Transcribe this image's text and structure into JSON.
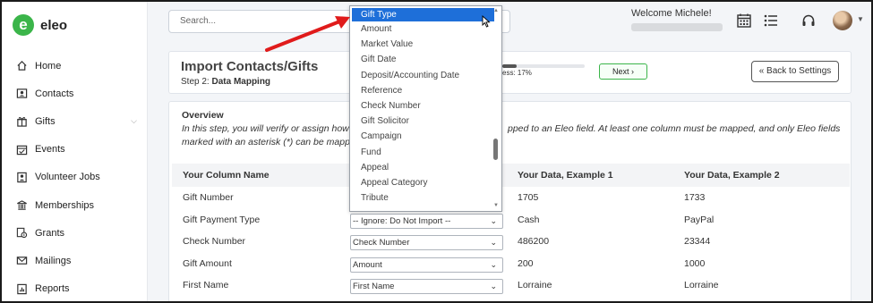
{
  "app": {
    "logo_letter": "e",
    "logo_text": "eleo"
  },
  "sidebar": {
    "items": [
      {
        "label": "Home",
        "icon": "home-icon"
      },
      {
        "label": "Contacts",
        "icon": "contacts-icon"
      },
      {
        "label": "Gifts",
        "icon": "gift-icon",
        "expandable": true
      },
      {
        "label": "Events",
        "icon": "events-icon"
      },
      {
        "label": "Volunteer Jobs",
        "icon": "volunteer-icon"
      },
      {
        "label": "Memberships",
        "icon": "membership-icon"
      },
      {
        "label": "Grants",
        "icon": "grants-icon"
      },
      {
        "label": "Mailings",
        "icon": "mail-icon"
      },
      {
        "label": "Reports",
        "icon": "reports-icon"
      }
    ]
  },
  "topbar": {
    "search_placeholder": "Search...",
    "welcome": "Welcome Michele!"
  },
  "header": {
    "title": "Import Contacts/Gifts",
    "step_prefix": "Step 2:",
    "step_name": "Data Mapping",
    "progress_label": "ess: 17%",
    "progress_value": 0.17,
    "next_label": "Next",
    "back_label": "Back to Settings"
  },
  "overview": {
    "title": "Overview",
    "line1_left": "In this step, you will verify or assign how e",
    "line1_right": "pped to an Eleo field. At least one column must be mapped, and only Eleo fields",
    "line2": "marked with an asterisk (*) can be mapped"
  },
  "table": {
    "headers": [
      "Your Column Name",
      "Your Data, Example 1",
      "Your Data, Example 2"
    ],
    "rows": [
      {
        "column": "Gift Number",
        "mapping": "",
        "ex1": "1705",
        "ex2": "1733"
      },
      {
        "column": "Gift Payment Type",
        "mapping": "-- Ignore: Do Not Import --",
        "ex1": "Cash",
        "ex2": "PayPal"
      },
      {
        "column": "Check Number",
        "mapping": "Check Number",
        "ex1": "486200",
        "ex2": "23344"
      },
      {
        "column": "Gift Amount",
        "mapping": "Amount",
        "ex1": "200",
        "ex2": "1000"
      },
      {
        "column": "First Name",
        "mapping": "First Name",
        "ex1": "Lorraine",
        "ex2": "Lorraine"
      }
    ]
  },
  "dropdown": {
    "selected": "Gift Type",
    "options": [
      "Gift Type",
      "Amount",
      "Market Value",
      "Gift Date",
      "Deposit/Accounting Date",
      "Reference",
      "Check Number",
      "Gift Solicitor",
      "Campaign",
      "Fund",
      "Appeal",
      "Appeal Category",
      "Tribute"
    ]
  },
  "colors": {
    "brand_green": "#3bb54a",
    "highlight_blue": "#1e6fd9",
    "arrow_red": "#e01b1b"
  }
}
